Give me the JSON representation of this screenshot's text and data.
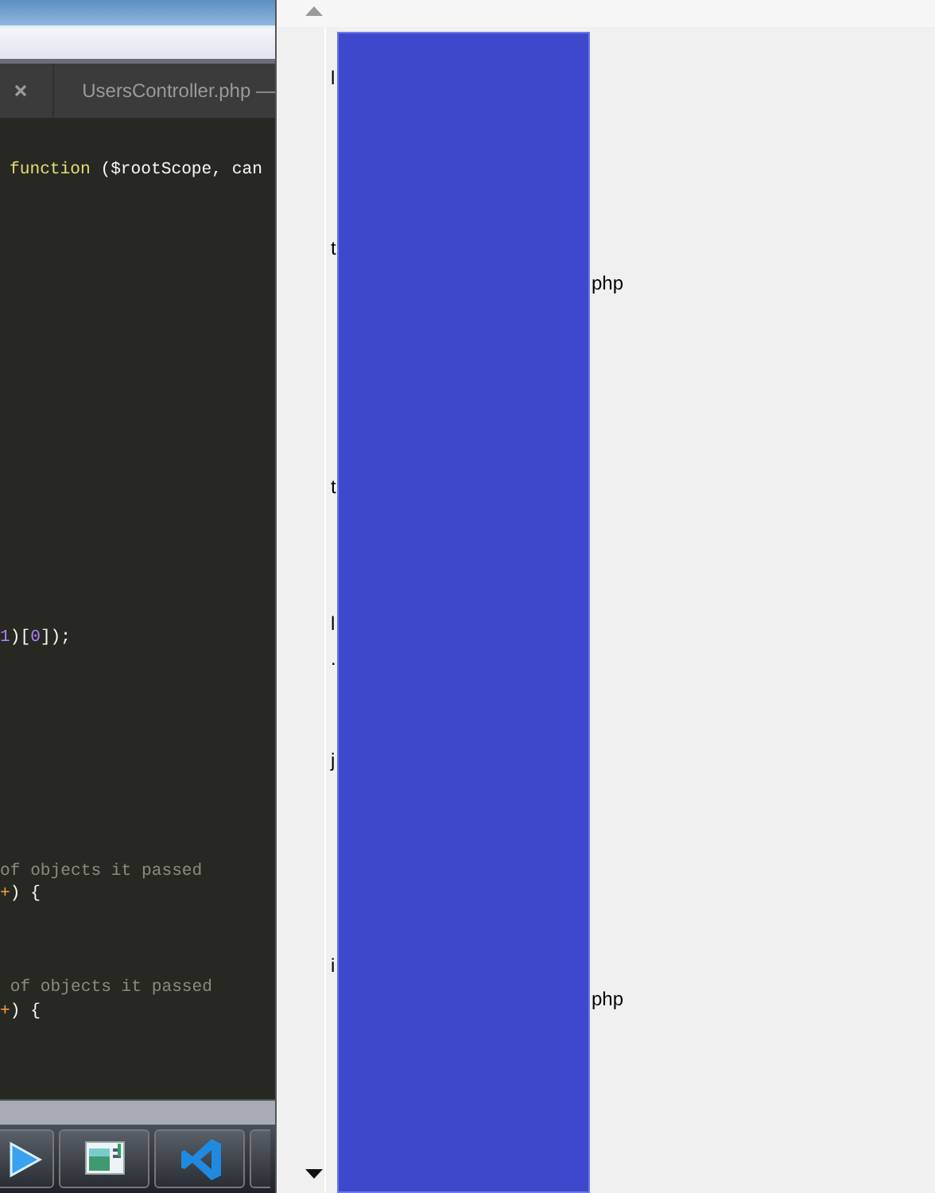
{
  "editor": {
    "tabs": [
      {
        "selected": false,
        "closable": true
      },
      {
        "label": "UsersController.php —",
        "selected": false,
        "closable": false
      }
    ],
    "code_lines": [
      {
        "tokens": [
          {
            "kind": "keyword",
            "text": "function"
          },
          {
            "kind": "plain",
            "text": " ($rootScope, can"
          }
        ]
      },
      {
        "tokens": [
          {
            "kind": "number",
            "text": "1"
          },
          {
            "kind": "plain",
            "text": ")["
          },
          {
            "kind": "number",
            "text": "0"
          },
          {
            "kind": "plain",
            "text": "]);"
          }
        ]
      },
      {
        "tokens": [
          {
            "kind": "comment",
            "text": "of objects it passed"
          }
        ]
      },
      {
        "tokens": [
          {
            "kind": "operator",
            "text": "+"
          },
          {
            "kind": "plain",
            "text": ") {"
          }
        ]
      },
      {
        "tokens": [
          {
            "kind": "comment",
            "text": " of objects it passed"
          }
        ]
      },
      {
        "tokens": [
          {
            "kind": "operator",
            "text": "+"
          },
          {
            "kind": "plain",
            "text": ") {"
          }
        ]
      }
    ]
  },
  "taskbar": {
    "buttons": [
      {
        "kind": "play"
      },
      {
        "kind": "window"
      },
      {
        "kind": "code"
      },
      {
        "kind": "blank"
      }
    ]
  },
  "file_list": {
    "rows": [
      {},
      {
        "prefix": "l"
      },
      {},
      {},
      {},
      {},
      {
        "prefix": "t"
      },
      {
        "suffix": "php"
      },
      {},
      {},
      {},
      {},
      {},
      {
        "prefix": "t"
      },
      {},
      {},
      {},
      {
        "prefix": "l"
      },
      {
        "prefix": "."
      },
      {},
      {},
      {
        "prefix": "j"
      },
      {},
      {},
      {},
      {},
      {},
      {
        "prefix": "i"
      },
      {
        "suffix": "php"
      },
      {},
      {},
      {},
      {}
    ]
  }
}
